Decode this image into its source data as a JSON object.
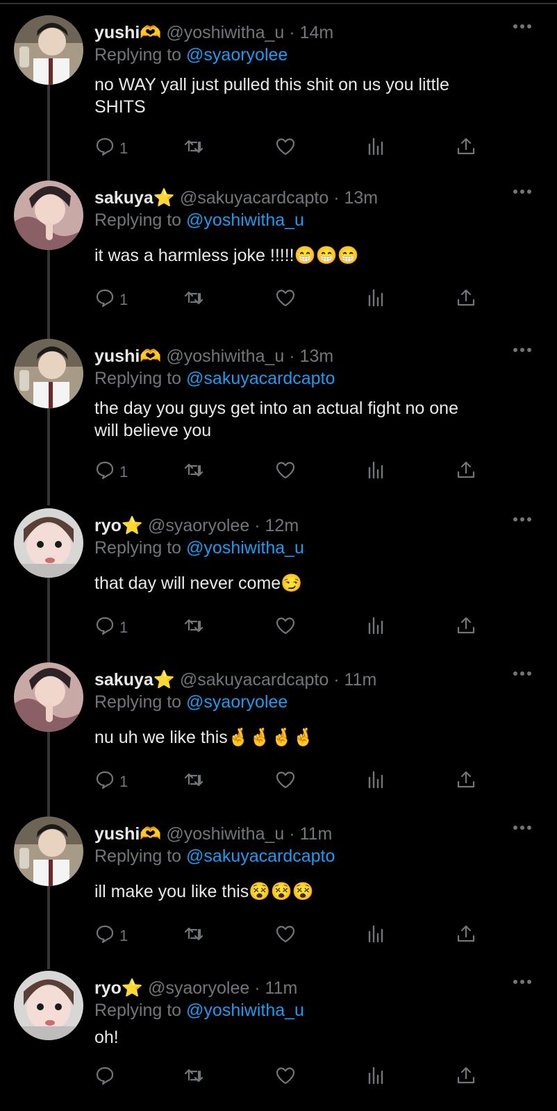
{
  "colors": {
    "background": "#000000",
    "text": "#e7e9ea",
    "muted": "#71767b",
    "link": "#1d9bf0",
    "thread_line": "#333639"
  },
  "icons": {
    "reply": "speech-bubble-icon",
    "retweet": "retweet-icon",
    "like": "heart-icon",
    "views": "bar-chart-icon",
    "share": "share-upload-icon",
    "more": "more-dots-icon"
  },
  "tweets": [
    {
      "display_name": "yushi🫶",
      "handle": "@yoshiwitha_u",
      "dot": "·",
      "time": "14m",
      "replying_prefix": "Replying to ",
      "replying_to": "@syaoryolee",
      "text": "no WAY yall just pulled this shit on us you little\nSHITS",
      "emoji": "",
      "reply_count": "1"
    },
    {
      "display_name": "sakuya⭐",
      "handle": "@sakuyacardcapto",
      "dot": "·",
      "time": "13m",
      "replying_prefix": "Replying to ",
      "replying_to": "@yoshiwitha_u",
      "text": "it was a harmless joke !!!!!",
      "emoji": "😁😁😁",
      "reply_count": "1"
    },
    {
      "display_name": "yushi🫶",
      "handle": "@yoshiwitha_u",
      "dot": "·",
      "time": "13m",
      "replying_prefix": "Replying to ",
      "replying_to": "@sakuyacardcapto",
      "text": "the day you guys get into an actual fight no one\nwill believe you",
      "emoji": "",
      "reply_count": "1"
    },
    {
      "display_name": "ryo⭐",
      "handle": "@syaoryolee",
      "dot": "·",
      "time": "12m",
      "replying_prefix": "Replying to ",
      "replying_to": "@yoshiwitha_u",
      "text": "that day will never come",
      "emoji": "😏",
      "reply_count": "1"
    },
    {
      "display_name": "sakuya⭐",
      "handle": "@sakuyacardcapto",
      "dot": "·",
      "time": "11m",
      "replying_prefix": "Replying to ",
      "replying_to": "@syaoryolee",
      "text": "nu uh we like this",
      "emoji": "🤞🤞🤞🤞",
      "reply_count": "1"
    },
    {
      "display_name": "yushi🫶",
      "handle": "@yoshiwitha_u",
      "dot": "·",
      "time": "11m",
      "replying_prefix": "Replying to ",
      "replying_to": "@sakuyacardcapto",
      "text": "ill make you like this",
      "emoji": "😵😵😵",
      "reply_count": "1"
    },
    {
      "display_name": "ryo⭐",
      "handle": "@syaoryolee",
      "dot": "·",
      "time": "11m",
      "replying_prefix": "Replying to ",
      "replying_to": "@yoshiwitha_u",
      "text": "oh!",
      "emoji": "",
      "reply_count": ""
    }
  ]
}
